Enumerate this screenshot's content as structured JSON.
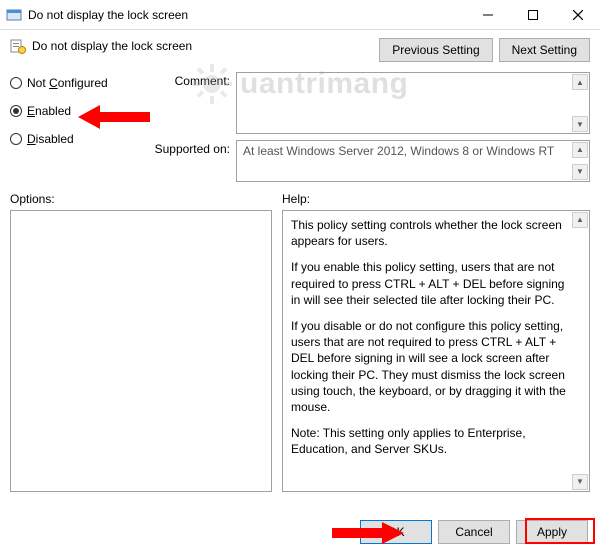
{
  "window": {
    "title": "Do not display the lock screen"
  },
  "subheader": {
    "policy_title": "Do not display the lock screen",
    "prev_btn": "Previous Setting",
    "next_btn": "Next Setting"
  },
  "radios": {
    "not_configured": "Not Configured",
    "enabled": "Enabled",
    "disabled": "Disabled",
    "selected": "enabled"
  },
  "fields": {
    "comment_label": "Comment:",
    "comment_value": "",
    "supported_label": "Supported on:",
    "supported_value": "At least Windows Server 2012, Windows 8 or Windows RT"
  },
  "lower": {
    "options_label": "Options:",
    "help_label": "Help:",
    "help_paragraphs": [
      "This policy setting controls whether the lock screen appears for users.",
      "If you enable this policy setting, users that are not required to press CTRL + ALT + DEL before signing in will see their selected tile after locking their PC.",
      "If you disable or do not configure this policy setting, users that are not required to press CTRL + ALT + DEL before signing in will see a lock screen after locking their PC. They must dismiss the lock screen using touch, the keyboard, or by dragging it with the mouse.",
      "Note: This setting only applies to Enterprise, Education, and Server SKUs."
    ]
  },
  "footer": {
    "ok": "OK",
    "cancel": "Cancel",
    "apply": "Apply"
  },
  "watermark": {
    "text": "uantrimang"
  }
}
